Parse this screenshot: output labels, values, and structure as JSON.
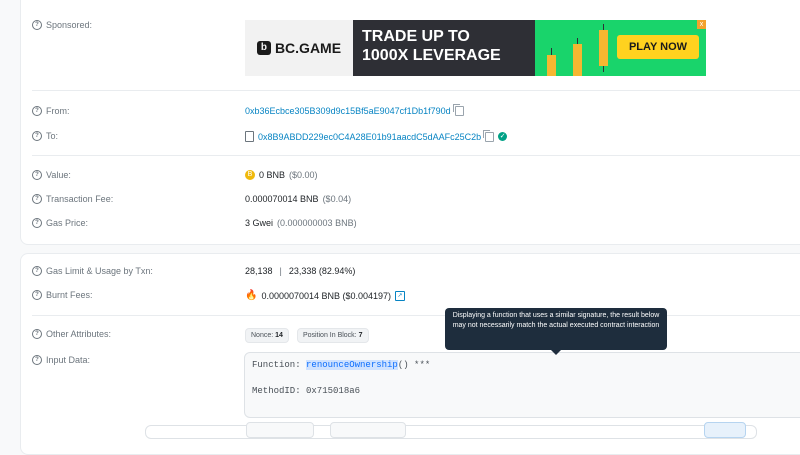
{
  "overview": {
    "sponsored": {
      "label": "Sponsored:"
    },
    "ad": {
      "brand": "BC.GAME",
      "headline_line1": "TRADE UP TO",
      "headline_line2": "1000X LEVERAGE",
      "cta": "PLAY NOW",
      "close": "x",
      "colors": {
        "background": "#19d46b",
        "cta": "#ffd21f",
        "headline_bg": "#2e2f35"
      }
    },
    "from": {
      "label": "From:",
      "address": "0xb36Ecbce305B309d9c15Bf5aE9047cf1Db1f790d"
    },
    "to": {
      "label": "To:",
      "address": "0x8B9ABDD229ec0C4A28E01b91aacdC5dAAFc25C2b"
    },
    "value": {
      "label": "Value:",
      "amount": "0 BNB",
      "usd": "($0.00)"
    },
    "fee": {
      "label": "Transaction Fee:",
      "amount": "0.000070014 BNB",
      "usd": "($0.04)"
    },
    "gas_price": {
      "label": "Gas Price:",
      "amount": "3 Gwei",
      "detail": "(0.000000003 BNB)"
    }
  },
  "details": {
    "gas_limit": {
      "label": "Gas Limit & Usage by Txn:",
      "limit": "28,138",
      "divider": "|",
      "usage": "23,338 (82.94%)"
    },
    "burnt_fees": {
      "label": "Burnt Fees:",
      "amount": "0.0000070014 BNB ($0.004197)"
    },
    "other_attributes": {
      "label": "Other Attributes:",
      "nonce_label": "Nonce:",
      "nonce_value": "14",
      "position_label": "Position In Block:",
      "position_value": "7"
    },
    "input_data": {
      "label": "Input Data:",
      "function_prefix": "Function: ",
      "function_name": "renounceOwnership",
      "function_suffix": "() ***",
      "method_id": "MethodID: 0x715018a6"
    },
    "tooltip": "Displaying a function that uses a similar signature, the result below may not necessarily match the actual executed contract interaction"
  },
  "icons": {
    "help": "?",
    "verified": "✓",
    "bnb": "B",
    "fire": "🔥",
    "external": "↗"
  }
}
